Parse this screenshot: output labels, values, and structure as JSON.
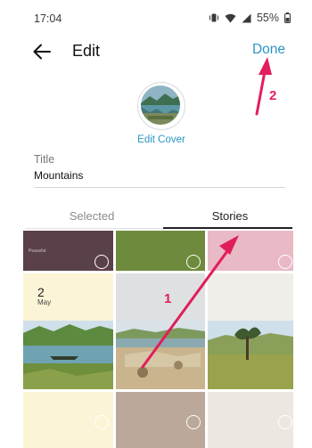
{
  "status_bar": {
    "time": "17:04",
    "battery": "55%"
  },
  "header": {
    "title": "Edit",
    "done_label": "Done"
  },
  "cover": {
    "label": "Edit Cover"
  },
  "title_field": {
    "label": "Title",
    "value": "Mountains"
  },
  "tabs": [
    {
      "label": "Selected",
      "active": false
    },
    {
      "label": "Stories",
      "active": true
    }
  ],
  "grid": {
    "story_date": {
      "day": "2",
      "month": "May"
    },
    "row1_caption": "Peaceful"
  },
  "annotations": {
    "step1": "1",
    "step2": "2",
    "color": "#e01e5a"
  },
  "colors": {
    "accent": "#2b95c4",
    "annotation": "#e01e5a"
  }
}
